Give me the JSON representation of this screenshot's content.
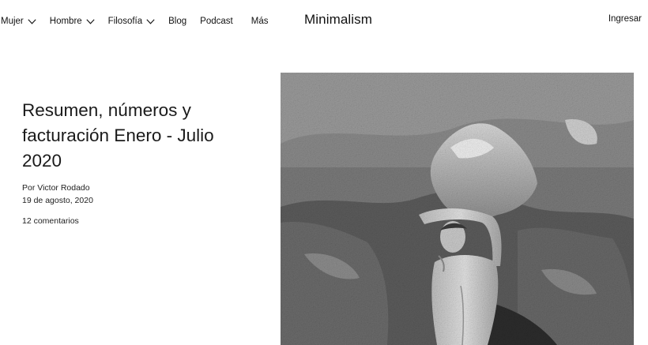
{
  "header": {
    "nav": [
      {
        "label": "Mujer",
        "has_dropdown": true
      },
      {
        "label": "Hombre",
        "has_dropdown": true
      },
      {
        "label": "Filosofía",
        "has_dropdown": true
      },
      {
        "label": "Blog",
        "has_dropdown": false
      },
      {
        "label": "Podcast",
        "has_dropdown": false
      },
      {
        "label": "Más",
        "has_dropdown": false
      }
    ],
    "brand": "Minimalism",
    "login": "Ingresar"
  },
  "article": {
    "title": "Resumen, números y facturación Enero - Julio 2020",
    "byline": "Por Victor Rodado",
    "date": "19 de agosto, 2020",
    "comments": "12 comentarios"
  },
  "icons": {
    "dropdown": "chevron-down-icon"
  },
  "colors": {
    "text": "#111111",
    "background": "#ffffff"
  }
}
